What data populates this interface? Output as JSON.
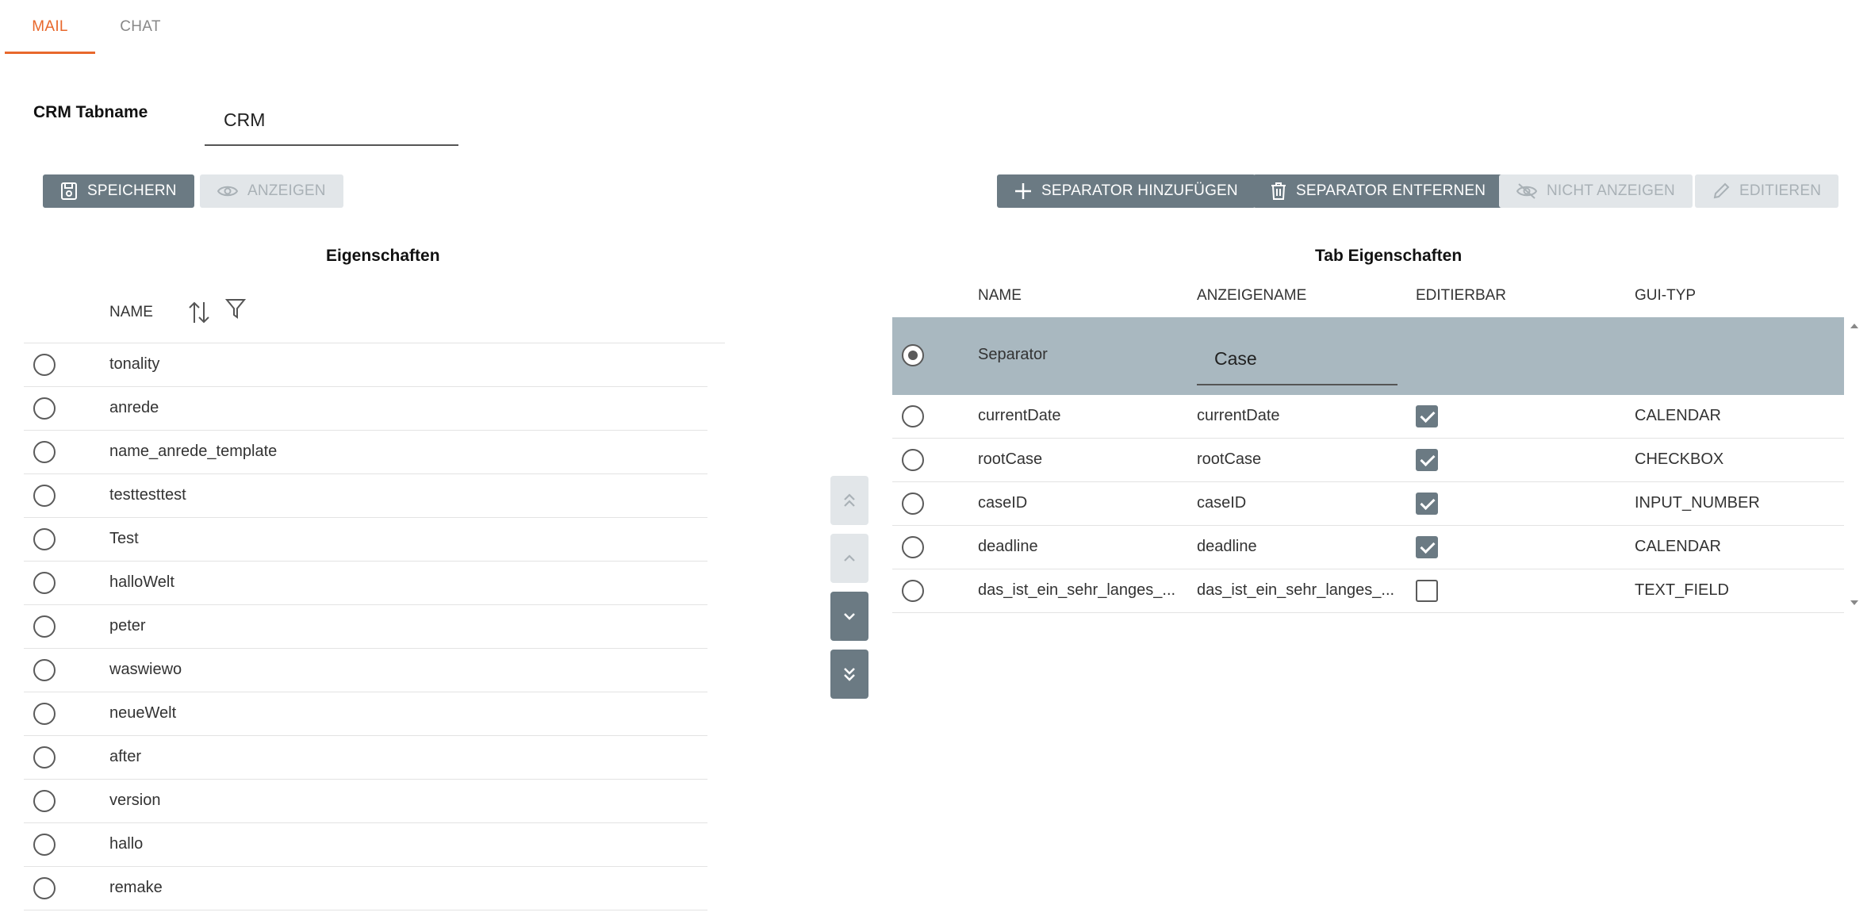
{
  "tabs": [
    {
      "label": "MAIL",
      "active": true
    },
    {
      "label": "CHAT",
      "active": false
    }
  ],
  "tabname": {
    "label": "CRM Tabname",
    "value": "CRM"
  },
  "toolbar": {
    "save_label": "SPEICHERN",
    "show_label": "ANZEIGEN",
    "add_separator_label": "SEPARATOR HINZUFÜGEN",
    "remove_separator_label": "SEPARATOR ENTFERNEN",
    "hide_label": "NICHT ANZEIGEN",
    "edit_label": "EDITIEREN"
  },
  "left": {
    "title": "Eigenschaften",
    "column_name": "NAME",
    "items": [
      "tonality",
      "anrede",
      "name_anrede_template",
      "testtesttest",
      "Test",
      "halloWelt",
      "peter",
      "waswiewo",
      "neueWelt",
      "after",
      "version",
      "hallo",
      "remake"
    ]
  },
  "right": {
    "title": "Tab Eigenschaften",
    "columns": [
      "NAME",
      "ANZEIGENAME",
      "EDITIERBAR",
      "GUI-TYP"
    ],
    "separator": {
      "name": "Separator",
      "display_value": "Case",
      "selected": true
    },
    "rows": [
      {
        "name": "currentDate",
        "display": "currentDate",
        "editable": true,
        "gui_type": "CALENDAR"
      },
      {
        "name": "rootCase",
        "display": "rootCase",
        "editable": true,
        "gui_type": "CHECKBOX"
      },
      {
        "name": "caseID",
        "display": "caseID",
        "editable": true,
        "gui_type": "INPUT_NUMBER"
      },
      {
        "name": "deadline",
        "display": "deadline",
        "editable": true,
        "gui_type": "CALENDAR"
      },
      {
        "name": "das_ist_ein_sehr_langes_...",
        "display": "das_ist_ein_sehr_langes_...",
        "editable": false,
        "gui_type": "TEXT_FIELD"
      }
    ]
  },
  "move_buttons": [
    {
      "icon": "double-chevron-up-icon",
      "enabled": false
    },
    {
      "icon": "chevron-up-icon",
      "enabled": false
    },
    {
      "icon": "chevron-down-icon",
      "enabled": true
    },
    {
      "icon": "double-chevron-down-icon",
      "enabled": true
    }
  ],
  "colors": {
    "accent": "#e8682c",
    "button": "#6b7a83",
    "button_disabled": "#e2e6e9",
    "selected_row": "#a9b8c0"
  }
}
